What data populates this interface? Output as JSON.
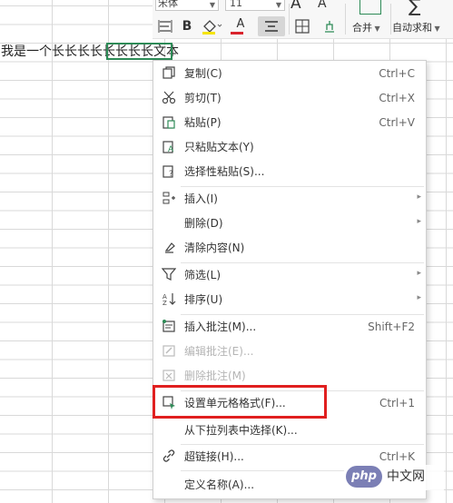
{
  "sheet": {
    "cell_text": "我是一个长长长长长长长长文本"
  },
  "toolbar": {
    "font_name": "宋体",
    "font_size": "11",
    "grow_font": "A",
    "shrink_font": "A",
    "bold": "B",
    "font_color_letter": "A",
    "merge_label": "合并",
    "autosum_label": "自动求和",
    "sigma": "∑",
    "accent_color": "#2e8b57",
    "font_color": "#d9232d"
  },
  "context_menu": {
    "items": [
      {
        "icon": "copy-icon",
        "label": "复制(C)",
        "shortcut": "Ctrl+C",
        "submenu": false,
        "disabled": false
      },
      {
        "icon": "cut-icon",
        "label": "剪切(T)",
        "shortcut": "Ctrl+X",
        "submenu": false,
        "disabled": false
      },
      {
        "icon": "paste-icon",
        "label": "粘贴(P)",
        "shortcut": "Ctrl+V",
        "submenu": false,
        "disabled": false
      },
      {
        "icon": "paste-text-icon",
        "label": "只粘贴文本(Y)",
        "shortcut": "",
        "submenu": false,
        "disabled": false
      },
      {
        "icon": "paste-special-icon",
        "label": "选择性粘贴(S)...",
        "shortcut": "",
        "submenu": false,
        "disabled": false
      },
      {
        "icon": "insert-icon",
        "label": "插入(I)",
        "shortcut": "",
        "submenu": true,
        "disabled": false
      },
      {
        "icon": "",
        "label": "删除(D)",
        "shortcut": "",
        "submenu": true,
        "disabled": false
      },
      {
        "icon": "clear-icon",
        "label": "清除内容(N)",
        "shortcut": "",
        "submenu": false,
        "disabled": false
      },
      {
        "icon": "filter-icon",
        "label": "筛选(L)",
        "shortcut": "",
        "submenu": true,
        "disabled": false
      },
      {
        "icon": "sort-icon",
        "label": "排序(U)",
        "shortcut": "",
        "submenu": true,
        "disabled": false
      },
      {
        "icon": "insert-comment-icon",
        "label": "插入批注(M)...",
        "shortcut": "Shift+F2",
        "submenu": false,
        "disabled": false
      },
      {
        "icon": "edit-comment-icon",
        "label": "编辑批注(E)...",
        "shortcut": "",
        "submenu": false,
        "disabled": true
      },
      {
        "icon": "delete-comment-icon",
        "label": "删除批注(M)",
        "shortcut": "",
        "submenu": false,
        "disabled": true
      },
      {
        "icon": "format-cells-icon",
        "label": "设置单元格格式(F)...",
        "shortcut": "Ctrl+1",
        "submenu": false,
        "disabled": false
      },
      {
        "icon": "",
        "label": "从下拉列表中选择(K)...",
        "shortcut": "",
        "submenu": false,
        "disabled": false
      },
      {
        "icon": "hyperlink-icon",
        "label": "超链接(H)...",
        "shortcut": "Ctrl+K",
        "submenu": false,
        "disabled": false
      },
      {
        "icon": "",
        "label": "定义名称(A)...",
        "shortcut": "",
        "submenu": false,
        "disabled": false
      }
    ],
    "highlight_color": "#e01f1f"
  },
  "watermark": {
    "logo": "php",
    "text": "中文网"
  }
}
